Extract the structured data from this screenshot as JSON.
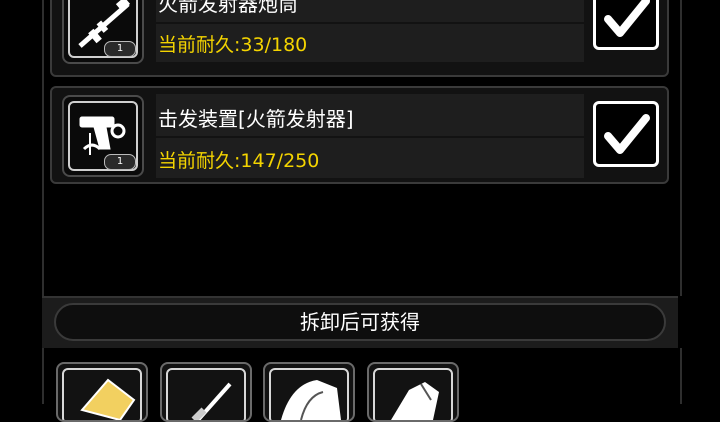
{
  "items": [
    {
      "name": "火箭发射器炮筒",
      "durability_label": "当前耐久:33/180",
      "count": "1",
      "icon": "rocket-launcher-icon",
      "checked": true
    },
    {
      "name": "击发装置[火箭发射器]",
      "durability_label": "当前耐久:147/250",
      "count": "1",
      "icon": "trigger-mechanism-icon",
      "checked": true
    }
  ],
  "section": {
    "title": "拆卸后可获得"
  },
  "rewards": [
    {
      "icon": "gold-plate-icon"
    },
    {
      "icon": "knife-icon"
    },
    {
      "icon": "cloth-icon"
    },
    {
      "icon": "leather-icon"
    }
  ],
  "colors": {
    "durability": "#f4d400",
    "background": "#000000"
  }
}
